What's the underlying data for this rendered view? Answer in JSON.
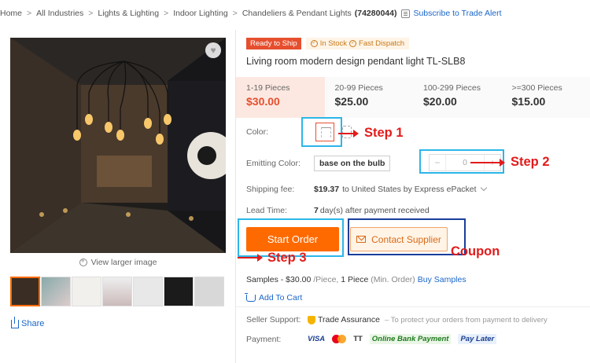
{
  "breadcrumb": {
    "items": [
      "Home",
      "All Industries",
      "Lights & Lighting",
      "Indoor Lighting",
      "Chandeliers & Pendant Lights"
    ],
    "separator": ">",
    "count": "(74280044)",
    "alert_link": "Subscribe to Trade Alert"
  },
  "gallery": {
    "view_larger": "View larger image",
    "share": "Share",
    "thumbnail_count": 7,
    "active_thumbnail": 0
  },
  "product": {
    "badge_ready": "Ready to Ship",
    "badge_stock": "In Stock",
    "badge_dispatch": "Fast Dispatch",
    "title": "Living room modern design pendant light TL-SLB8"
  },
  "price_tiers": [
    {
      "qty": "1-19 Pieces",
      "price": "$30.00",
      "active": true
    },
    {
      "qty": "20-99 Pieces",
      "price": "$25.00",
      "active": false
    },
    {
      "qty": "100-299 Pieces",
      "price": "$20.00",
      "active": false
    },
    {
      "qty": ">=300 Pieces",
      "price": "$15.00",
      "active": false
    }
  ],
  "options": {
    "color_label": "Color:",
    "emitting_label": "Emitting Color:",
    "emitting_value": "base on the bulb",
    "stepper_minus": "−",
    "stepper_value": "0",
    "stepper_plus": "+"
  },
  "shipping": {
    "label": "Shipping fee:",
    "amount": "$19.37",
    "detail": "to United States by Express ePacket"
  },
  "lead_time": {
    "label": "Lead Time:",
    "days": "7",
    "detail": "day(s) after payment received"
  },
  "buttons": {
    "start_order": "Start Order",
    "contact_supplier": "Contact Supplier"
  },
  "samples": {
    "prefix": "Samples - $30.00",
    "unit": "/Piece,",
    "qty": "1 Piece",
    "min": "(Min. Order)",
    "link": "Buy Samples"
  },
  "add_to_cart": "Add To Cart",
  "support": {
    "label": "Seller Support:",
    "trade_assurance": "Trade Assurance",
    "note": "– To protect your orders from payment to delivery"
  },
  "payment": {
    "label": "Payment:",
    "methods": [
      "VISA",
      "TT",
      "Online Bank Payment",
      "Pay Later"
    ]
  },
  "annotations": {
    "step1": "Step 1",
    "step2": "Step 2",
    "step3": "Step 3",
    "coupon": "Coupon",
    "step_color": "#e31b1b",
    "box_cyan": "#2cb6e8",
    "box_navy": "#1a3e9c"
  },
  "colors": {
    "accent_orange": "#ff6a00",
    "price_red": "#e64f2e",
    "link_blue": "#1a66c9"
  }
}
